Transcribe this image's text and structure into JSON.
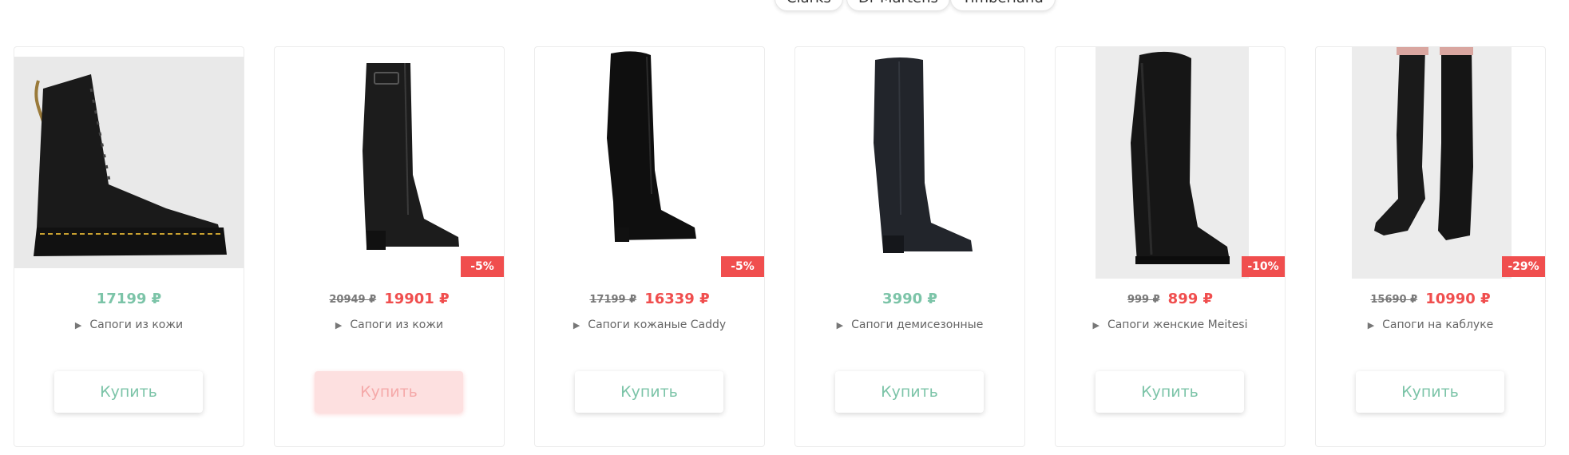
{
  "brand_tags": [
    "Clarks",
    "Dr Martens",
    "Timberland"
  ],
  "colors": {
    "accent_green": "#7cc4a8",
    "sale_red": "#f04e4e",
    "old_price_gray": "#7a7a7a"
  },
  "products": [
    {
      "image": "black-leather-lace-up-boot-image",
      "price": "17199 ₽",
      "title": "Сапоги из кожи",
      "buy_label": "Купить"
    },
    {
      "image": "black-knee-high-buckle-boot-image",
      "old_price": "20949 ₽",
      "new_price": "19901 ₽",
      "discount": "-5%",
      "title": "Сапоги из кожи",
      "buy_label": "Купить"
    },
    {
      "image": "black-suede-over-knee-boot-image",
      "old_price": "17199 ₽",
      "new_price": "16339 ₽",
      "discount": "-5%",
      "title": "Сапоги кожаные Caddy",
      "buy_label": "Купить"
    },
    {
      "image": "black-knee-high-boot-image",
      "price": "3990 ₽",
      "title": "Сапоги демисезонные",
      "buy_label": "Купить"
    },
    {
      "image": "black-suede-tall-boot-image",
      "old_price": "999 ₽",
      "new_price": "899 ₽",
      "discount": "-10%",
      "title": "Сапоги женские Meitesi",
      "buy_label": "Купить"
    },
    {
      "image": "black-heeled-knee-boots-on-model-image",
      "old_price": "15690 ₽",
      "new_price": "10990 ₽",
      "discount": "-29%",
      "title": "Сапоги на каблуке",
      "buy_label": "Купить"
    }
  ]
}
